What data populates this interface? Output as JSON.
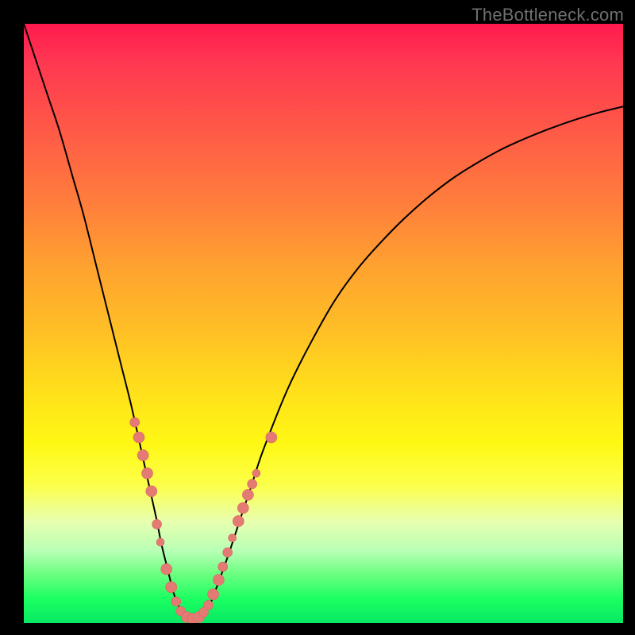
{
  "watermark": "TheBottleneck.com",
  "chart_data": {
    "type": "line",
    "title": "",
    "xlabel": "",
    "ylabel": "",
    "xlim": [
      0,
      100
    ],
    "ylim": [
      0,
      100
    ],
    "curve": {
      "x": [
        0,
        2,
        4,
        6,
        8,
        10,
        12,
        14,
        16,
        18,
        20,
        22,
        23,
        24,
        25,
        26,
        27,
        28,
        29,
        30,
        31,
        32,
        34,
        36,
        38,
        40,
        44,
        48,
        52,
        56,
        60,
        64,
        68,
        72,
        76,
        80,
        84,
        88,
        92,
        96,
        100
      ],
      "y": [
        100,
        94,
        88,
        82,
        75,
        68,
        60,
        52,
        44,
        36,
        27,
        18,
        13,
        9,
        5,
        2.5,
        1.2,
        0.7,
        0.8,
        1.5,
        3.0,
        5.5,
        11,
        17,
        23,
        29,
        39,
        47,
        54,
        59.5,
        64,
        68,
        71.5,
        74.5,
        77,
        79.2,
        81,
        82.6,
        84,
        85.2,
        86.2
      ]
    },
    "points": [
      {
        "x": 18.5,
        "y": 33.5,
        "r": 6
      },
      {
        "x": 19.2,
        "y": 31.0,
        "r": 7
      },
      {
        "x": 19.9,
        "y": 28.0,
        "r": 7
      },
      {
        "x": 20.6,
        "y": 25.0,
        "r": 7
      },
      {
        "x": 21.3,
        "y": 22.0,
        "r": 7
      },
      {
        "x": 22.2,
        "y": 16.5,
        "r": 6
      },
      {
        "x": 22.8,
        "y": 13.5,
        "r": 5
      },
      {
        "x": 23.8,
        "y": 9.0,
        "r": 7
      },
      {
        "x": 24.6,
        "y": 6.0,
        "r": 7
      },
      {
        "x": 25.4,
        "y": 3.6,
        "r": 6
      },
      {
        "x": 26.2,
        "y": 2.0,
        "r": 6
      },
      {
        "x": 27.2,
        "y": 1.0,
        "r": 7
      },
      {
        "x": 28.2,
        "y": 0.7,
        "r": 7
      },
      {
        "x": 29.2,
        "y": 1.0,
        "r": 7
      },
      {
        "x": 30.0,
        "y": 1.8,
        "r": 6
      },
      {
        "x": 30.8,
        "y": 3.0,
        "r": 6
      },
      {
        "x": 31.6,
        "y": 4.8,
        "r": 7
      },
      {
        "x": 32.5,
        "y": 7.2,
        "r": 7
      },
      {
        "x": 33.2,
        "y": 9.4,
        "r": 6
      },
      {
        "x": 34.0,
        "y": 11.8,
        "r": 6
      },
      {
        "x": 34.8,
        "y": 14.2,
        "r": 5
      },
      {
        "x": 35.8,
        "y": 17.0,
        "r": 7
      },
      {
        "x": 36.6,
        "y": 19.2,
        "r": 7
      },
      {
        "x": 37.4,
        "y": 21.4,
        "r": 7
      },
      {
        "x": 38.1,
        "y": 23.2,
        "r": 6
      },
      {
        "x": 38.8,
        "y": 25.0,
        "r": 5
      },
      {
        "x": 41.3,
        "y": 31.0,
        "r": 7
      }
    ],
    "gradient_stops": [
      {
        "pos": 0,
        "color": "#ff1a4d"
      },
      {
        "pos": 30,
        "color": "#ff7e3c"
      },
      {
        "pos": 62,
        "color": "#ffe21a"
      },
      {
        "pos": 83,
        "color": "#e8ffb0"
      },
      {
        "pos": 100,
        "color": "#08e863"
      }
    ]
  }
}
